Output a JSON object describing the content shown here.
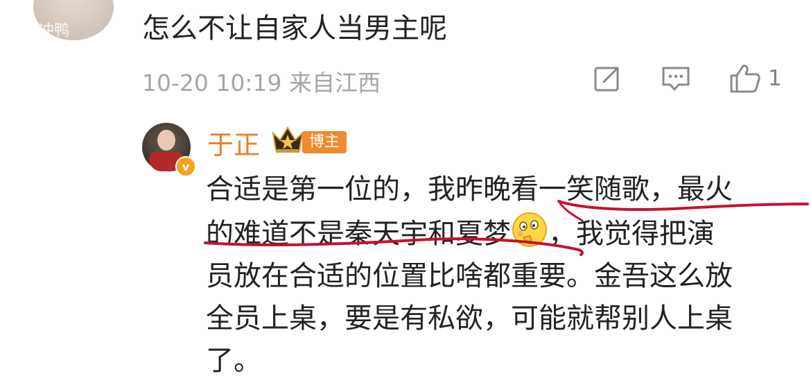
{
  "comment": {
    "avatar_text": "冲鸭",
    "text": "怎么不让自家人当男主呢",
    "meta": "10-20 10:19  来自江西",
    "actions": {
      "share_icon": "share-icon",
      "reply_icon": "comment-icon",
      "like_icon": "thumbs-up-icon",
      "like_count": "1"
    }
  },
  "reply": {
    "author": "于正",
    "badge": "博主",
    "verified_icon": "v",
    "lines": [
      "合适是第一位的，我昨晚看一笑随歌，最火",
      "的难道不是秦天宇和夏梦",
      "，我觉得把演",
      "员放在合适的位置比啥都重要。金吾这么放",
      "全员上桌，要是有私欲，可能就帮别人上桌",
      "了。"
    ]
  },
  "colors": {
    "name": "#e87f29",
    "badge": "#f08a2c",
    "underline": "#c8102e",
    "meta": "#a6a6a6",
    "text": "#222222"
  }
}
